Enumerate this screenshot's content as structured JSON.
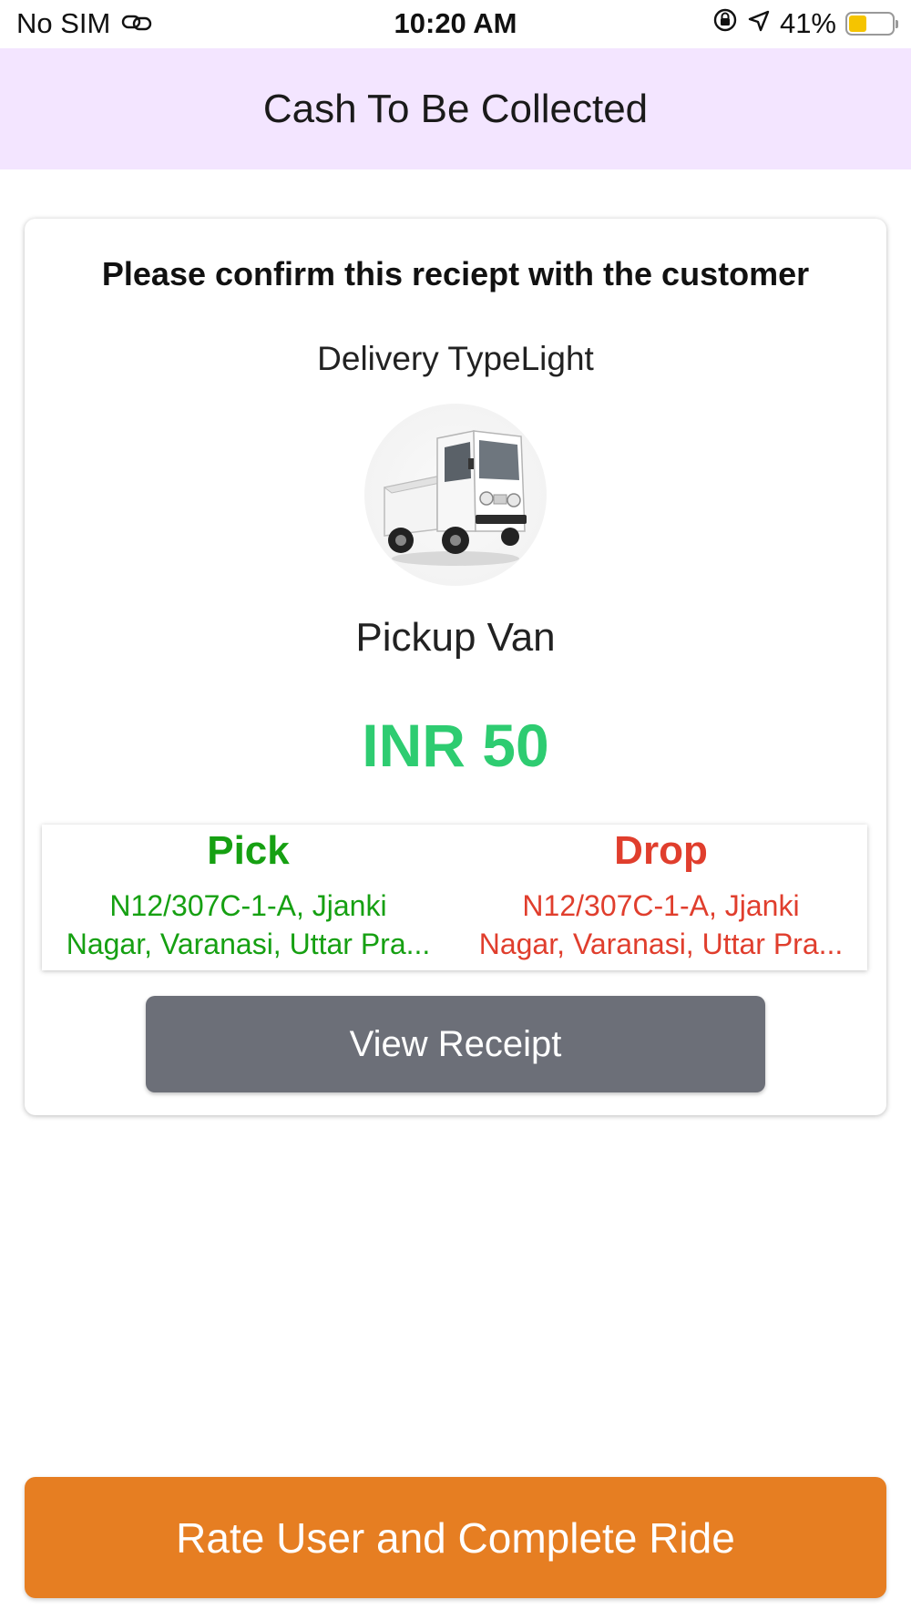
{
  "status_bar": {
    "carrier": "No SIM",
    "time": "10:20 AM",
    "battery_percent": "41%",
    "battery_level": 0.41,
    "battery_color": "#f5c400",
    "icons": [
      "link-icon",
      "orientation-lock-icon",
      "location-arrow-icon",
      "battery-icon"
    ]
  },
  "header": {
    "title": "Cash To Be Collected",
    "background": "#f3e5ff"
  },
  "card": {
    "confirm_text": "Please confirm this reciept with the customer",
    "delivery_type": "Delivery TypeLight",
    "vehicle_image_icon": "pickup-van-image",
    "vehicle_name": "Pickup Van",
    "price": "INR 50",
    "price_color": "#2ecc71",
    "pick": {
      "heading": "Pick",
      "address": "N12/307C-1-A, Jjanki\nNagar, Varanasi, Uttar Pra...",
      "color": "#16a012"
    },
    "drop": {
      "heading": "Drop",
      "address": "N12/307C-1-A, Jjanki\nNagar, Varanasi, Uttar Pra...",
      "color": "#e03e2d"
    },
    "view_receipt_label": "View Receipt"
  },
  "footer": {
    "complete_label": "Rate User and Complete Ride",
    "button_color": "#e67e22"
  }
}
